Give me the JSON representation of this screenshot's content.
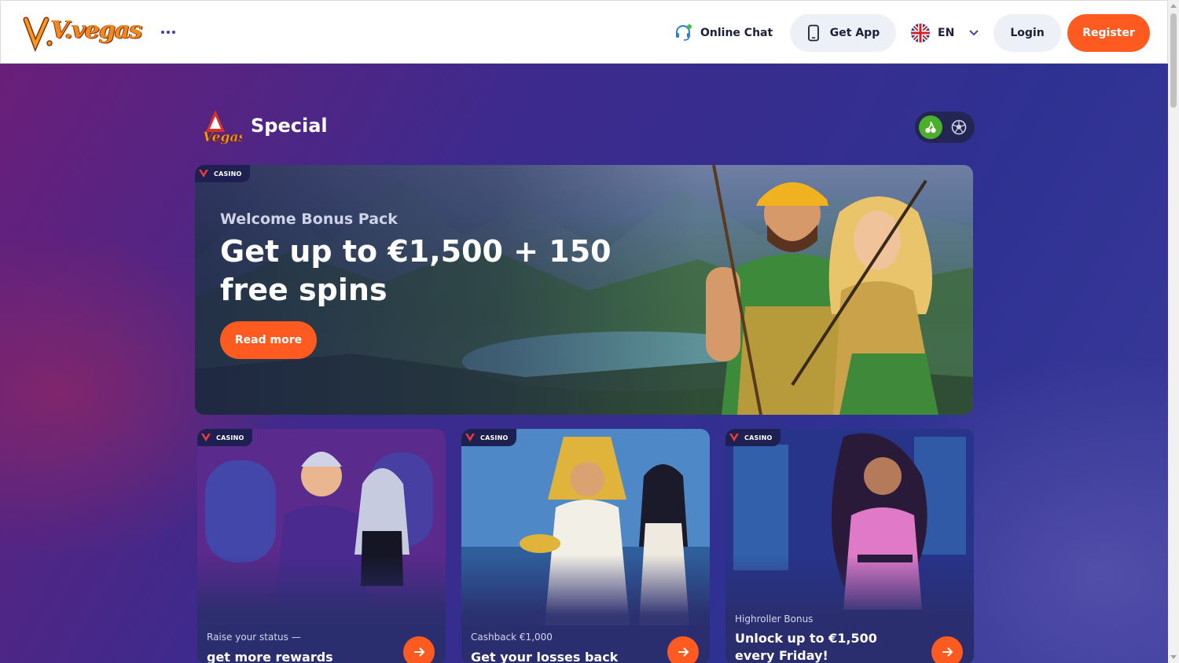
{
  "header": {
    "logo_text": "V.vegas",
    "online_chat_label": "Online Chat",
    "get_app_label": "Get App",
    "language_code": "EN",
    "login_label": "Login",
    "register_label": "Register"
  },
  "section": {
    "title": "Special",
    "toggle": {
      "options": [
        "cherry-icon",
        "soccer-ball-icon"
      ],
      "active": "cherry-icon"
    }
  },
  "hero": {
    "badge": "CASINO",
    "subtitle": "Welcome Bonus Pack",
    "title": "Get up to €1,500 + 150 free spins",
    "cta_label": "Read more"
  },
  "cards": [
    {
      "badge": "CASINO",
      "subtitle": "Raise your status —",
      "title": "get more rewards"
    },
    {
      "badge": "CASINO",
      "subtitle": "Cashback €1,000",
      "title": "Get your losses back"
    },
    {
      "badge": "CASINO",
      "subtitle": "Highroller Bonus",
      "title": "Unlock up to €1,500 every Friday!"
    }
  ],
  "colors": {
    "accent": "#ff5a1f",
    "active_toggle": "#4caf2b",
    "header_bg": "#ffffff",
    "nav_text": "#1c1f3b"
  }
}
